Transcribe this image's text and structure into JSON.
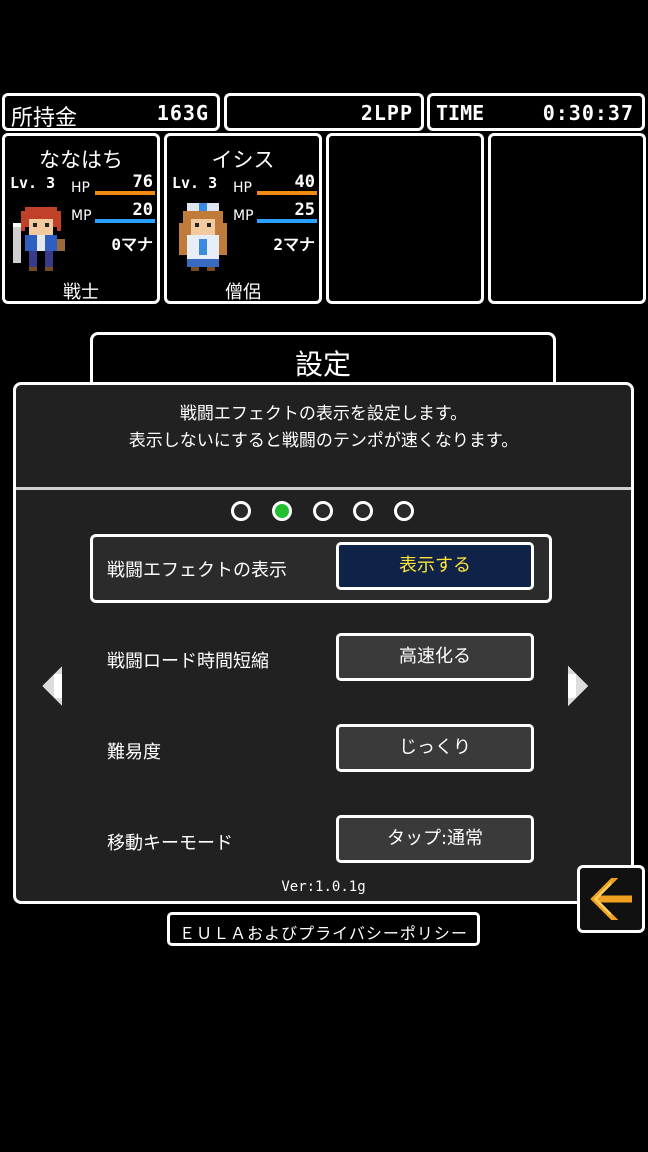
{
  "status_bar": {
    "gold_label": "所持金",
    "gold_value": "163G",
    "lpp_value": "2LPP",
    "time_label": "TIME",
    "time_value": "0:30:37"
  },
  "party": [
    {
      "name": "ななはち",
      "level_label": "Lv.",
      "level": "3",
      "hp_label": "HP",
      "hp": "76",
      "mp_label": "MP",
      "mp": "20",
      "mana": "0マナ",
      "job": "戦士"
    },
    {
      "name": "イシス",
      "level_label": "Lv.",
      "level": "3",
      "hp_label": "HP",
      "hp": "40",
      "mp_label": "MP",
      "mp": "25",
      "mana": "2マナ",
      "job": "僧侶"
    }
  ],
  "colors": {
    "hp_bar": "#f08a10",
    "mp_bar": "#2aa0ff",
    "selected_button_bg": "#0f2247",
    "selected_button_text": "#ffe23a",
    "active_page_dot": "#22c030",
    "back_arrow": "#f0a020"
  },
  "settings": {
    "title": "設定",
    "description_line1": "戦闘エフェクトの表示を設定します。",
    "description_line2": "表示しないにすると戦闘のテンポが速くなります。",
    "page_dots": 5,
    "active_page": 2,
    "rows": [
      {
        "label": "戦闘エフェクトの表示",
        "value": "表示する"
      },
      {
        "label": "戦闘ロード時間短縮",
        "value": "高速化る"
      },
      {
        "label": "難易度",
        "value": "じっくり"
      },
      {
        "label": "移動キーモード",
        "value": "タップ:通常"
      }
    ],
    "version": "Ver:1.0.1g"
  },
  "icons": {
    "prev": "left-triangle-icon",
    "next": "right-triangle-icon",
    "back": "back-arrow-icon"
  },
  "eula_label": "ＥＵＬＡおよびプライバシーポリシー"
}
